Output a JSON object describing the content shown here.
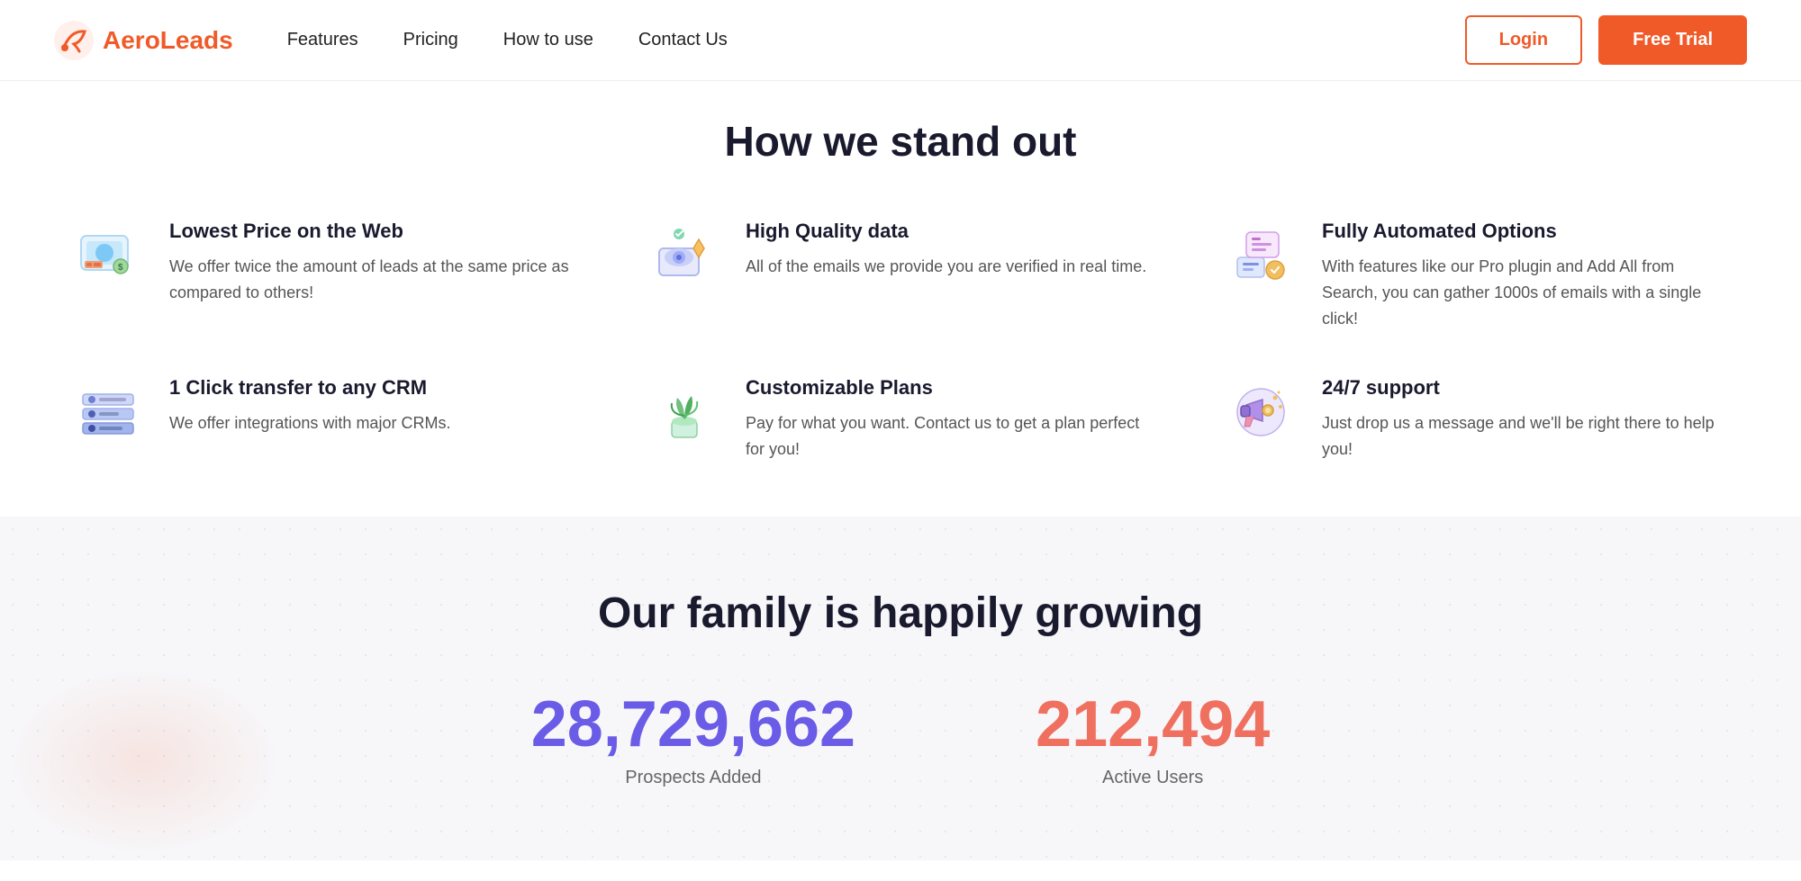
{
  "nav": {
    "logo_text": "AeroLeads",
    "links": [
      {
        "label": "Features",
        "href": "#"
      },
      {
        "label": "Pricing",
        "href": "#"
      },
      {
        "label": "How to use",
        "href": "#"
      },
      {
        "label": "Contact Us",
        "href": "#"
      }
    ],
    "login_label": "Login",
    "trial_label": "Free Trial"
  },
  "stand_out": {
    "title": "How we stand out"
  },
  "features": [
    {
      "id": "lowest-price",
      "title": "Lowest Price on the Web",
      "desc": "We offer twice the amount of leads at the same price as compared to others!",
      "icon": "price-icon"
    },
    {
      "id": "high-quality",
      "title": "High Quality data",
      "desc": "All of the emails we provide you are verified in real time.",
      "icon": "quality-icon"
    },
    {
      "id": "automated",
      "title": "Fully Automated Options",
      "desc": "With features like our Pro plugin and Add All from Search, you can gather 1000s of emails with a single click!",
      "icon": "automation-icon"
    },
    {
      "id": "crm",
      "title": "1 Click transfer to any CRM",
      "desc": "We offer integrations with major CRMs.",
      "icon": "crm-icon"
    },
    {
      "id": "customizable",
      "title": "Customizable Plans",
      "desc": "Pay for what you want. Contact us to get a plan perfect for you!",
      "icon": "plans-icon"
    },
    {
      "id": "support",
      "title": "24/7 support",
      "desc": "Just drop us a message and we'll be right there to help you!",
      "icon": "support-icon"
    }
  ],
  "stats": {
    "title": "Our family is happily growing",
    "items": [
      {
        "number": "28,729,662",
        "label": "Prospects Added",
        "color": "purple"
      },
      {
        "number": "212,494",
        "label": "Active Users",
        "color": "coral"
      }
    ]
  }
}
